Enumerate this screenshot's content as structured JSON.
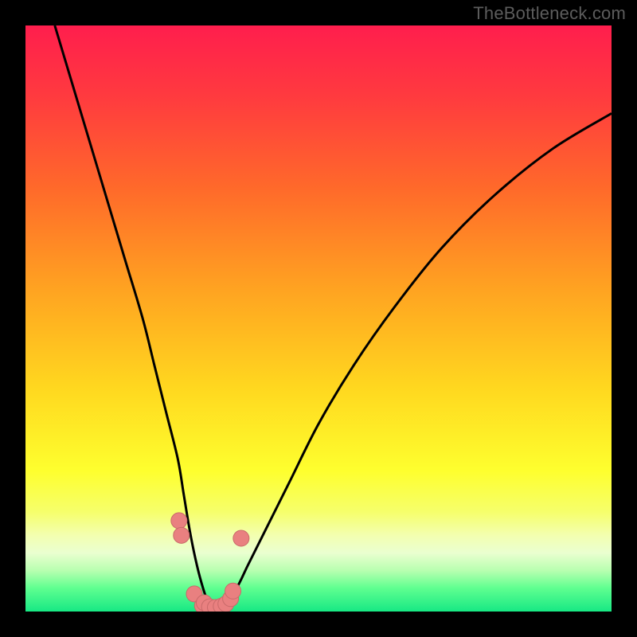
{
  "watermark": {
    "text": "TheBottleneck.com"
  },
  "colors": {
    "bg": "#000000",
    "curve": "#000000",
    "marker_fill": "#e98080",
    "marker_stroke": "#c96a6a",
    "gradient_stops": [
      {
        "offset": 0.0,
        "color": "#ff1e4d"
      },
      {
        "offset": 0.12,
        "color": "#ff3a3f"
      },
      {
        "offset": 0.28,
        "color": "#ff6a2a"
      },
      {
        "offset": 0.45,
        "color": "#ffa321"
      },
      {
        "offset": 0.62,
        "color": "#ffd81f"
      },
      {
        "offset": 0.76,
        "color": "#feff2e"
      },
      {
        "offset": 0.83,
        "color": "#f6ff6b"
      },
      {
        "offset": 0.87,
        "color": "#f3ffb0"
      },
      {
        "offset": 0.9,
        "color": "#eaffd0"
      },
      {
        "offset": 0.93,
        "color": "#b8ffb0"
      },
      {
        "offset": 0.96,
        "color": "#5fff90"
      },
      {
        "offset": 1.0,
        "color": "#17e884"
      }
    ]
  },
  "chart_data": {
    "type": "line",
    "title": "",
    "xlabel": "",
    "ylabel": "",
    "xlim": [
      0,
      100
    ],
    "ylim": [
      0,
      100
    ],
    "grid": false,
    "legend": false,
    "note": "V-shaped bottleneck curve; y reads as mismatch from 100 (top) down to 0 (bottom). Values estimated from pixel positions.",
    "series": [
      {
        "name": "bottleneck-curve",
        "x": [
          5,
          8,
          11,
          14,
          17,
          20,
          22,
          24,
          26,
          27,
          28,
          29,
          30,
          31,
          32,
          33,
          34,
          36,
          38,
          41,
          45,
          50,
          56,
          63,
          71,
          80,
          90,
          100
        ],
        "y": [
          100,
          90,
          80,
          70,
          60,
          50,
          42,
          34,
          26,
          20,
          14,
          9,
          5,
          2,
          1,
          1,
          2,
          4,
          8,
          14,
          22,
          32,
          42,
          52,
          62,
          71,
          79,
          85
        ]
      }
    ],
    "markers": {
      "name": "highlight-dots",
      "style": "scatter",
      "x": [
        26.2,
        26.6,
        28.8,
        30.2,
        30.5,
        31.4,
        32.4,
        33.4,
        34.2,
        35.0,
        35.4,
        36.8
      ],
      "y": [
        15.5,
        13.0,
        3.0,
        1.0,
        1.5,
        0.8,
        0.7,
        0.9,
        1.3,
        2.2,
        3.5,
        12.5
      ]
    }
  }
}
